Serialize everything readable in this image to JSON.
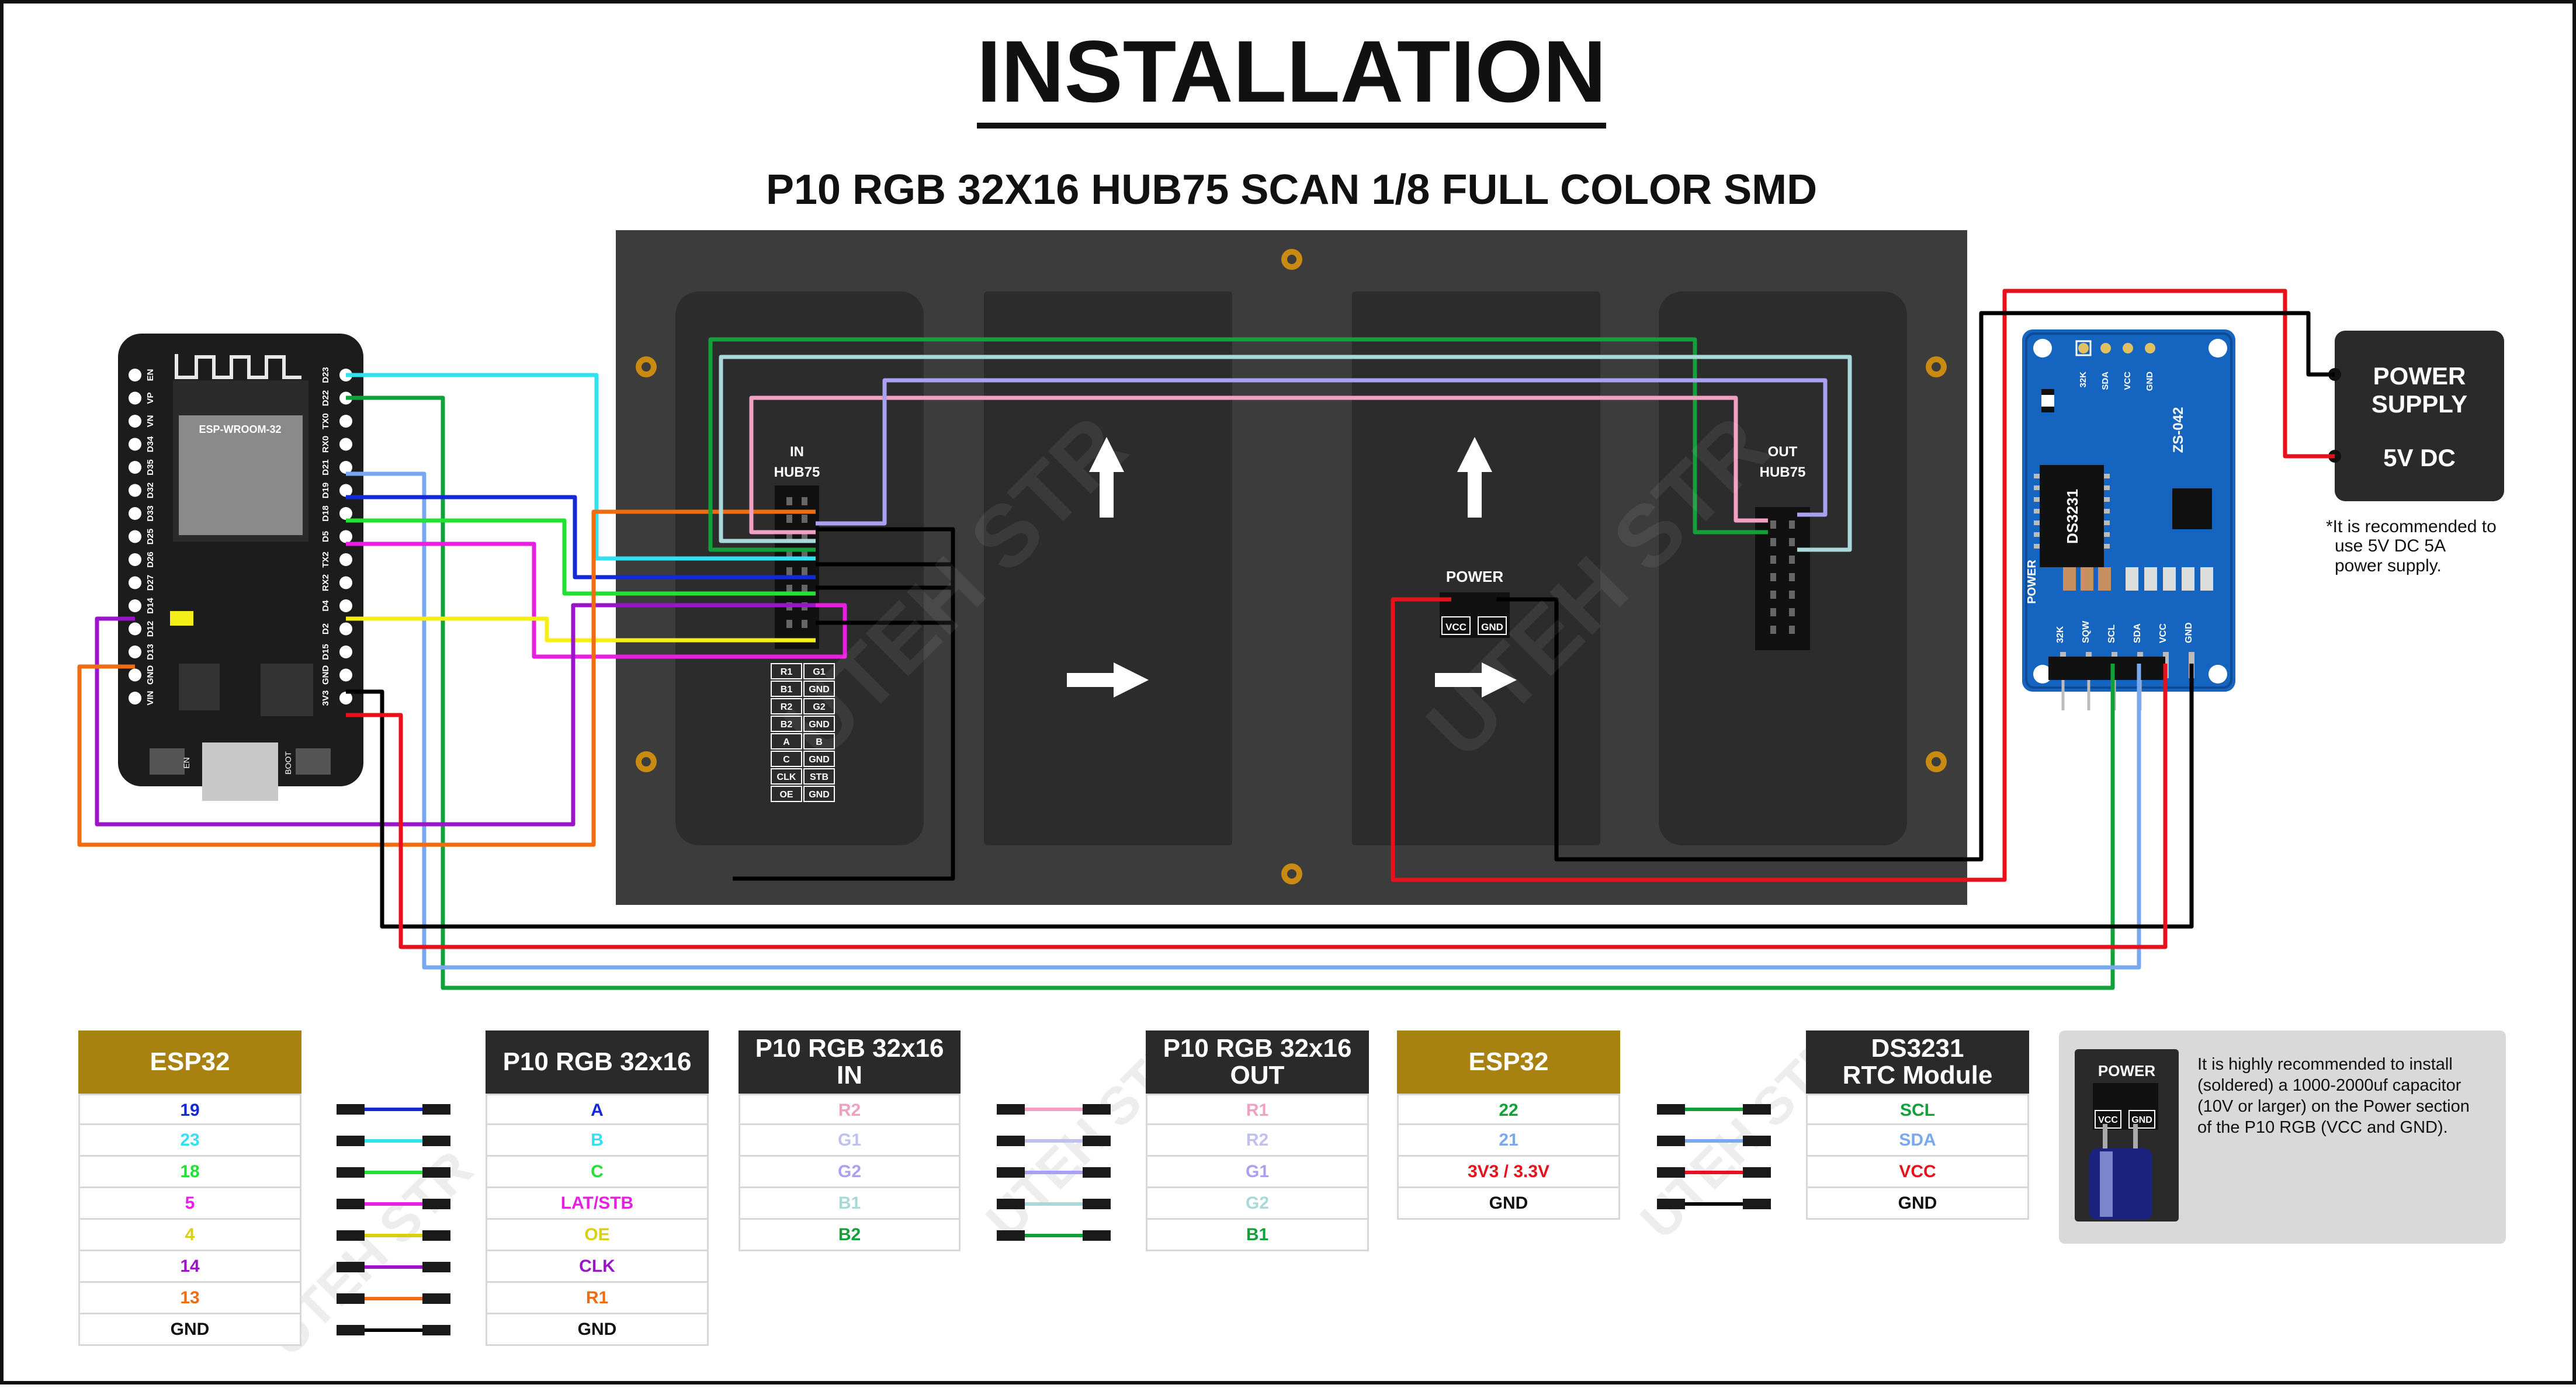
{
  "title": "INSTALLATION",
  "subtitle": "P10 RGB 32X16 HUB75 SCAN 1/8 FULL COLOR SMD",
  "watermark": "UTEH STR",
  "colors": {
    "gold": "#a88210",
    "dark": "#2a2a2a",
    "panel": "#3c3c3c",
    "red": "#e8101a",
    "black": "#000000",
    "cyan": "#33e0f0",
    "green": "#12a03a",
    "lightblue": "#7aa8f0",
    "blue": "#1428d6",
    "lime": "#22e034",
    "magenta": "#e81ee0",
    "yellow": "#f4ee1a",
    "purple": "#9a14c8",
    "orange": "#f06c10",
    "pink": "#f0a0c0",
    "lavender": "#a8a0f0",
    "paleblue": "#a8d8d8"
  },
  "esp32": {
    "module": "ESP-WROOM-32",
    "left_pins": [
      "EN",
      "VP",
      "VN",
      "D34",
      "D35",
      "D32",
      "D33",
      "D25",
      "D26",
      "D27",
      "D14",
      "D12",
      "D13",
      "GND",
      "VIN"
    ],
    "right_pins": [
      "D23",
      "D22",
      "TX0",
      "RX0",
      "D21",
      "D19",
      "D18",
      "D5",
      "TX2",
      "RX2",
      "D4",
      "D2",
      "D15",
      "GND",
      "3V3"
    ],
    "buttons": [
      "EN",
      "BOOT"
    ]
  },
  "panel": {
    "in_label_1": "IN",
    "in_label_2": "HUB75",
    "out_label_1": "OUT",
    "out_label_2": "HUB75",
    "power_label": "POWER",
    "vcc": "VCC",
    "gnd": "GND",
    "pin_table": [
      [
        "R1",
        "G1"
      ],
      [
        "B1",
        "GND"
      ],
      [
        "R2",
        "G2"
      ],
      [
        "B2",
        "GND"
      ],
      [
        "A",
        "B"
      ],
      [
        "C",
        "GND"
      ],
      [
        "CLK",
        "STB"
      ],
      [
        "OE",
        "GND"
      ]
    ]
  },
  "rtc": {
    "chip": "DS3231",
    "model": "ZS-042",
    "top_pins": [
      "32K",
      "SDA",
      "VCC",
      "GND"
    ],
    "bottom_pins": [
      "32K",
      "SQW",
      "SCL",
      "SDA",
      "VCC",
      "GND"
    ],
    "power_text": "POWER"
  },
  "power_supply": {
    "line1": "POWER",
    "line2": "SUPPLY",
    "line3": "5V DC",
    "note_1": "*It is recommended to",
    "note_2": "use 5V DC 5A",
    "note_3": "power supply."
  },
  "tables": {
    "esp32_a": {
      "header": "ESP32",
      "rows": [
        {
          "text": "19",
          "color": "#1428d6"
        },
        {
          "text": "23",
          "color": "#33e0f0"
        },
        {
          "text": "18",
          "color": "#22e034"
        },
        {
          "text": "5",
          "color": "#e81ee0"
        },
        {
          "text": "4",
          "color": "#d8d010"
        },
        {
          "text": "14",
          "color": "#9a14c8"
        },
        {
          "text": "13",
          "color": "#f06c10"
        },
        {
          "text": "GND",
          "color": "#111111"
        }
      ]
    },
    "p10_a": {
      "header": "P10 RGB 32x16",
      "rows": [
        {
          "text": "A",
          "color": "#1428d6"
        },
        {
          "text": "B",
          "color": "#33e0f0"
        },
        {
          "text": "C",
          "color": "#22e034"
        },
        {
          "text": "LAT/STB",
          "color": "#e81ee0"
        },
        {
          "text": "OE",
          "color": "#d8d010"
        },
        {
          "text": "CLK",
          "color": "#9a14c8"
        },
        {
          "text": "R1",
          "color": "#f06c10"
        },
        {
          "text": "GND",
          "color": "#111111"
        }
      ]
    },
    "p10_in": {
      "header_1": "P10 RGB 32x16",
      "header_2": "IN",
      "rows": [
        {
          "text": "R2",
          "color": "#f0a0c0"
        },
        {
          "text": "G1",
          "color": "#c0c0f0"
        },
        {
          "text": "G2",
          "color": "#a8a0f0"
        },
        {
          "text": "B1",
          "color": "#a8d8d8"
        },
        {
          "text": "B2",
          "color": "#12a03a"
        }
      ]
    },
    "p10_out": {
      "header_1": "P10 RGB 32x16",
      "header_2": "OUT",
      "rows": [
        {
          "text": "R1",
          "color": "#f0a0c0"
        },
        {
          "text": "R2",
          "color": "#c0c0f0"
        },
        {
          "text": "G1",
          "color": "#a8a0f0"
        },
        {
          "text": "G2",
          "color": "#a8d8d8"
        },
        {
          "text": "B1",
          "color": "#12a03a"
        }
      ]
    },
    "esp32_b": {
      "header": "ESP32",
      "rows": [
        {
          "text": "22",
          "color": "#12a03a"
        },
        {
          "text": "21",
          "color": "#7aa8f0"
        },
        {
          "text": "3V3 / 3.3V",
          "color": "#e8101a"
        },
        {
          "text": "GND",
          "color": "#111111"
        }
      ]
    },
    "ds3231": {
      "header_1": "DS3231",
      "header_2": "RTC Module",
      "rows": [
        {
          "text": "SCL",
          "color": "#12a03a"
        },
        {
          "text": "SDA",
          "color": "#7aa8f0"
        },
        {
          "text": "VCC",
          "color": "#e8101a"
        },
        {
          "text": "GND",
          "color": "#111111"
        }
      ]
    }
  },
  "capacitor_note": {
    "power": "POWER",
    "vcc": "VCC",
    "gnd": "GND",
    "line1": "It is highly recommended to install",
    "line2": "(soldered) a 1000-2000uf capacitor",
    "line3": "(10V or larger) on the Power section",
    "line4": "of the P10 RGB (VCC and GND)."
  }
}
